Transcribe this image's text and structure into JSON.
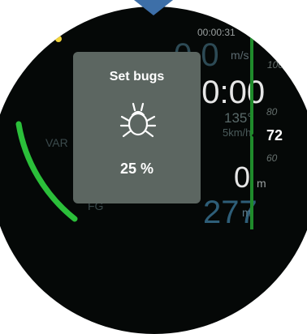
{
  "status": {
    "clock": "00:00:31"
  },
  "instruments": {
    "speed_value": "0.0",
    "speed_unit": "m/s",
    "time_value": "00:00",
    "heading": "135°",
    "wind": "5km/h",
    "altitude_value": "0",
    "altitude_unit": "m",
    "agl_value": "277",
    "agl_unit": "m",
    "var_label": "VAR",
    "fg_label": "FG"
  },
  "tape": {
    "tick_100": "100",
    "tick_80": "80",
    "tick_60": "60",
    "current": "72"
  },
  "dialog": {
    "title": "Set bugs",
    "icon": "bug-icon",
    "value": "25 %"
  },
  "colors": {
    "accent_green": "#2bbf3a",
    "dialog_bg": "#5c6661",
    "gps_dot": "#f0d23a"
  }
}
